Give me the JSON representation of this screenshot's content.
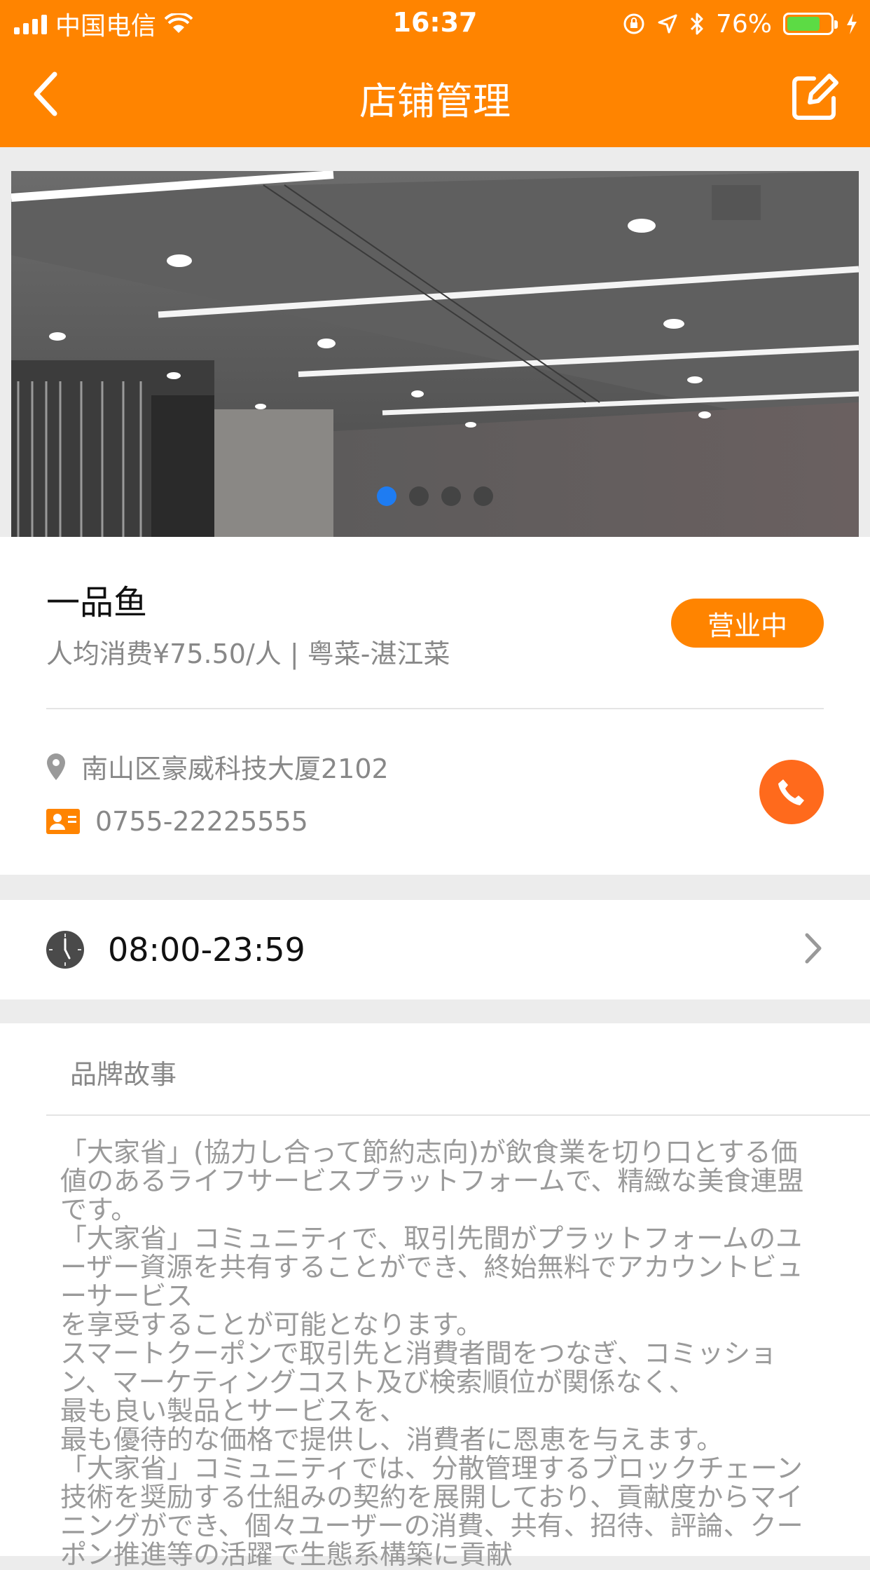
{
  "status_bar": {
    "carrier": "中国电信",
    "time": "16:37",
    "battery": "76%",
    "battery_level": 0.76
  },
  "nav": {
    "title": "店铺管理",
    "back_icon": "chevron-left-icon",
    "edit_icon": "edit-icon"
  },
  "banner": {
    "slide_count": 4,
    "active_index": 0,
    "active_dot_color": "#1e7cf2"
  },
  "store": {
    "name": "一品鱼",
    "meta": "人均消费¥75.50/人 | 粤菜-湛江菜",
    "status": "营业中",
    "address": "南山区豪威科技大厦2102",
    "phone": "0755-22225555"
  },
  "hours": {
    "value": "08:00-23:59"
  },
  "story": {
    "title": "品牌故事",
    "text": "「大家省」(協力し合って節約志向)が飲食業を切り口とする価値のあるライフサービスプラットフォームで、精緻な美食連盟です。\n「大家省」コミュニティで、取引先間がプラットフォームのユーザー資源を共有することができ、終始無料でアカウントビューサービス\nを享受することが可能となります。\nスマートクーポンで取引先と消費者間をつなぎ、コミッション、マーケティングコスト及び検索順位が関係なく、\n最も良い製品とサービスを、\n最も優待的な価格で提供し、消費者に恩恵を与えます。\n「大家省」コミュニティでは、分散管理するブロックチェーン技術を奨励する仕組みの契約を展開しており、貢献度からマイニングができ、個々ユーザーの消費、共有、招待、評論、クーポン推進等の活躍で生態系構築に貢献"
  },
  "colors": {
    "brand": "#ff8400",
    "call_button": "#ff6a1c"
  }
}
